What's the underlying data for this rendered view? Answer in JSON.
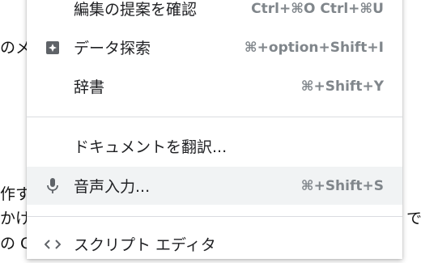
{
  "document_fragments": [
    "のメ",
    "作す",
    "かけ",
    "の C",
    "で"
  ],
  "menu": {
    "items": [
      {
        "label": "編集の提案を確認",
        "shortcut": "Ctrl+⌘O Ctrl+⌘U",
        "icon": "none"
      },
      {
        "label": "データ探索",
        "shortcut": "⌘+option+Shift+I",
        "icon": "explore-sparkle-icon"
      },
      {
        "label": "辞書",
        "shortcut": "⌘+Shift+Y",
        "icon": "none"
      },
      {
        "label": "ドキュメントを翻訳...",
        "shortcut": "",
        "icon": "none"
      },
      {
        "label": "音声入力...",
        "shortcut": "⌘+Shift+S",
        "icon": "microphone-icon",
        "highlighted": true
      },
      {
        "label": "スクリプト エディタ",
        "shortcut": "",
        "icon": "code-icon"
      }
    ]
  },
  "colors": {
    "menu_background": "#ffffff",
    "highlight": "#f1f3f4",
    "text": "#202124",
    "shortcut_text": "#80868b",
    "icon": "#5f6368",
    "separator": "#dadce0"
  }
}
